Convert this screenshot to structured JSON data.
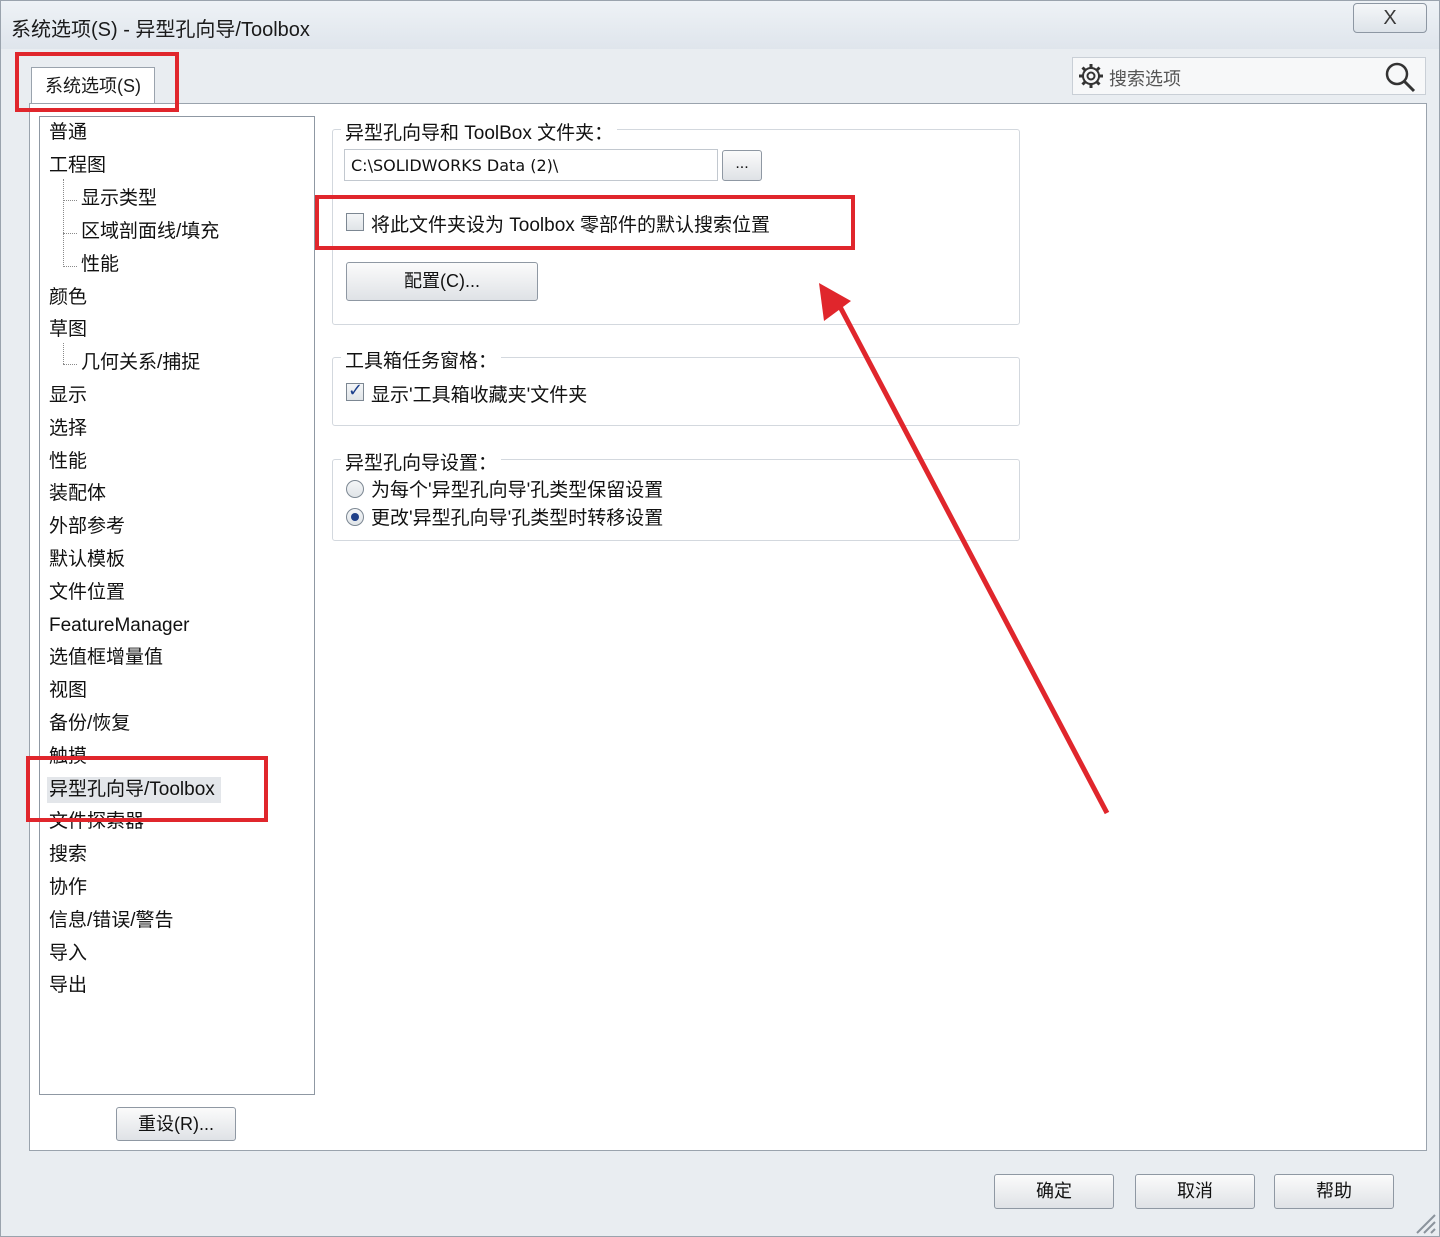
{
  "window": {
    "title": "系统选项(S) - 异型孔向导/Toolbox",
    "close_label": "X"
  },
  "tab": {
    "label": "系统选项(S)"
  },
  "search": {
    "placeholder": "搜索选项"
  },
  "tree": {
    "items": [
      {
        "label": "普通"
      },
      {
        "label": "工程图"
      },
      {
        "label": "显示类型"
      },
      {
        "label": "区域剖面线/填充"
      },
      {
        "label": "性能"
      },
      {
        "label": "颜色"
      },
      {
        "label": "草图"
      },
      {
        "label": "几何关系/捕捉"
      },
      {
        "label": "显示"
      },
      {
        "label": "选择"
      },
      {
        "label": "性能"
      },
      {
        "label": "装配体"
      },
      {
        "label": "外部参考"
      },
      {
        "label": "默认模板"
      },
      {
        "label": "文件位置"
      },
      {
        "label": "FeatureManager"
      },
      {
        "label": "选值框增量值"
      },
      {
        "label": "视图"
      },
      {
        "label": "备份/恢复"
      },
      {
        "label": "触摸"
      },
      {
        "label": "异型孔向导/Toolbox",
        "selected": true
      },
      {
        "label": "文件探索器"
      },
      {
        "label": "搜索"
      },
      {
        "label": "协作"
      },
      {
        "label": "信息/错误/警告"
      },
      {
        "label": "导入"
      },
      {
        "label": "导出"
      }
    ]
  },
  "reset_button": "重设(R)...",
  "folder_group": {
    "title": "异型孔向导和 ToolBox 文件夹：",
    "path_value": "C:\\SOLIDWORKS Data (2)\\",
    "browse_label": "...",
    "default_search_checkbox": {
      "label": "将此文件夹设为 Toolbox 零部件的默认搜索位置",
      "checked": false
    },
    "configure_button": "配置(C)..."
  },
  "taskpane_group": {
    "title": "工具箱任务窗格：",
    "show_favorites_checkbox": {
      "label": "显示'工具箱收藏夹'文件夹",
      "checked": true
    }
  },
  "hole_wizard_group": {
    "title": "异型孔向导设置：",
    "radio_options": [
      {
        "label": "为每个'异型孔向导'孔类型保留设置",
        "selected": false
      },
      {
        "label": "更改'异型孔向导'孔类型时转移设置",
        "selected": true
      }
    ]
  },
  "footer": {
    "ok_label": "确定",
    "cancel_label": "取消",
    "help_label": "帮助"
  },
  "colors": {
    "highlight": "#e0262c",
    "background": "#e9edf1",
    "panel": "#ffffff"
  },
  "icons": [
    "gear-icon",
    "search-icon",
    "close-icon",
    "resize-grip-icon"
  ]
}
